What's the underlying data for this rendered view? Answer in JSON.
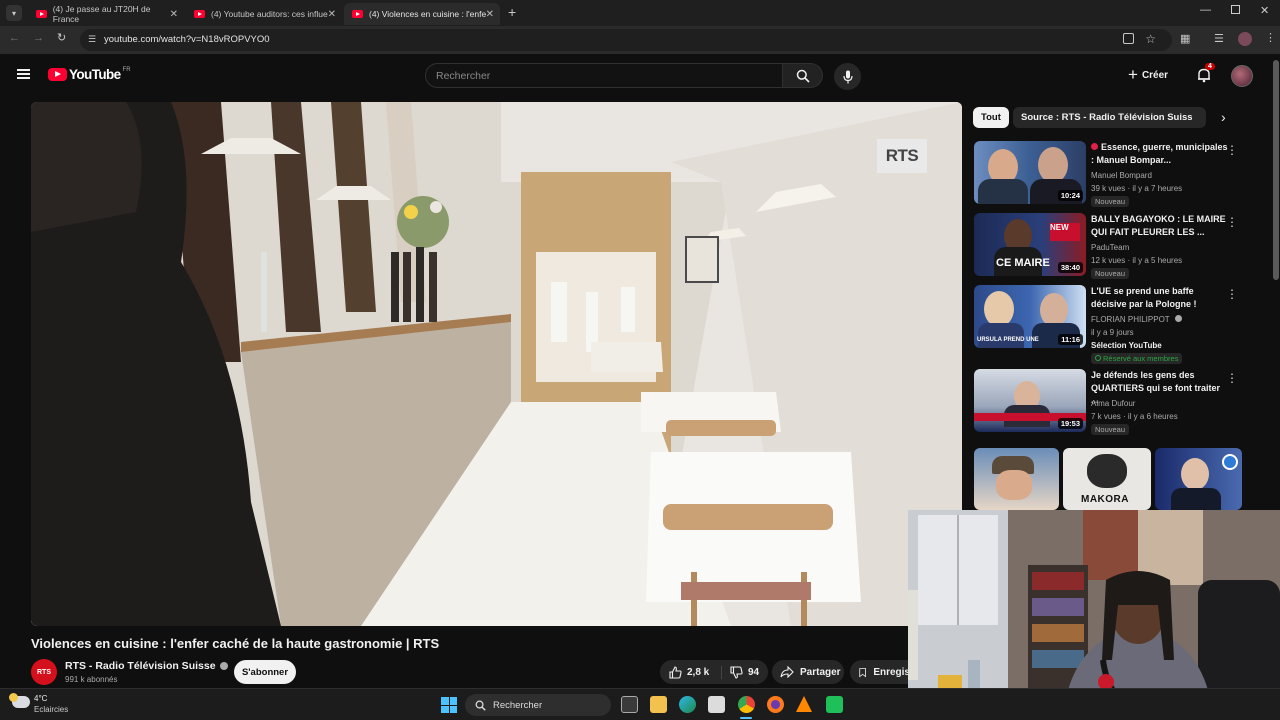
{
  "browser": {
    "tabs": [
      {
        "label": "(4) Je passe au JT20H de France"
      },
      {
        "label": "(4) Youtube auditors: ces influe"
      },
      {
        "label": "(4) Violences en cuisine : l'enfe"
      }
    ],
    "new_tab_label": "+",
    "url": "youtube.com/watch?v=N18vROPVYO0"
  },
  "header": {
    "logo_text": "YouTube",
    "logo_region": "FR",
    "search_placeholder": "Rechercher",
    "create_label": "Créer",
    "notification_count": "4"
  },
  "video": {
    "watermark": "RTS",
    "title": "Violences en cuisine : l'enfer caché de la haute gastronomie | RTS"
  },
  "channel": {
    "avatar_text": "RTS",
    "name": "RTS - Radio Télévision Suisse",
    "subscribers": "991 k abonnés",
    "subscribe_label": "S'abonner"
  },
  "actions": {
    "likes": "2,8 k",
    "dislikes": "94",
    "share_label": "Partager",
    "save_label": "Enregis"
  },
  "sidebar": {
    "chips": [
      {
        "label": "Tout"
      },
      {
        "label": "Source : RTS - Radio Télévision Suisse"
      }
    ],
    "recommendations": [
      {
        "title": "Essence, guerre, municipales : Manuel Bompar...",
        "channel": "Manuel Bompard",
        "meta": "39 k vues · il y a 7 heures",
        "badge": "Nouveau",
        "duration": "10:24"
      },
      {
        "title": "BALLY BAGAYOKO : LE MAIRE QUI FAIT PLEURER LES ...",
        "channel": "PaduTeam",
        "meta": "12 k vues · il y a 5 heures",
        "badge": "Nouveau",
        "duration": "38:40",
        "thumb_text": "CE MAIRE"
      },
      {
        "title": "L'UE se prend une baffe décisive par la Pologne !",
        "channel": "FLORIAN PHILIPPOT",
        "meta": "il y a 9 jours",
        "extra": "Sélection YouTube",
        "members": "Réservé aux membres",
        "duration": "11:16",
        "thumb_text": "URSULA PREND UNE"
      },
      {
        "title": "Je défends les gens des QUARTIERS qui se font traiter ...",
        "channel": "Alma Dufour",
        "meta": "7 k vues · il y a 6 heures",
        "badge": "Nouveau",
        "duration": "19:53"
      }
    ],
    "shorts_text": "MAKORA"
  },
  "taskbar": {
    "weather_temp": "4°C",
    "weather_desc": "Eclaircies",
    "search_label": "Rechercher"
  },
  "colors": {
    "youtube_red": "#ff0033",
    "background": "#0f0f0f",
    "chip_active": "#f1f1f1",
    "members_green": "#2ba640"
  }
}
